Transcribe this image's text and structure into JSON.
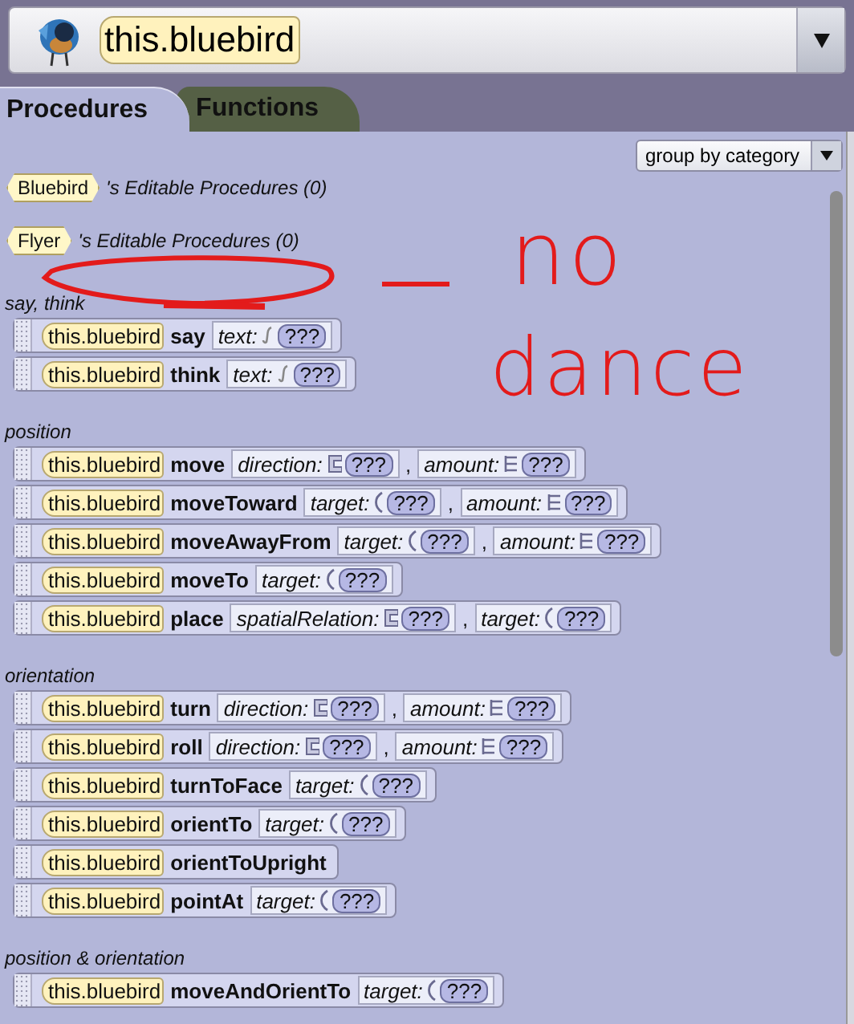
{
  "object_selector": {
    "value": "this.bluebird"
  },
  "tabs": [
    {
      "label": "Procedures",
      "selected": true
    },
    {
      "label": "Functions",
      "selected": false
    }
  ],
  "grouping": {
    "value": "group by category"
  },
  "editable_procedures": [
    {
      "type": "Bluebird",
      "label": "'s Editable Procedures (0)"
    },
    {
      "type": "Flyer",
      "label": "'s Editable Procedures (0)"
    }
  ],
  "categories": [
    {
      "name": "say, think",
      "blocks": [
        {
          "target": "this.bluebird",
          "method": "say",
          "params": [
            {
              "kind": "text",
              "label": "text:",
              "value": "???"
            }
          ]
        },
        {
          "target": "this.bluebird",
          "method": "think",
          "params": [
            {
              "kind": "text",
              "label": "text:",
              "value": "???"
            }
          ]
        }
      ]
    },
    {
      "name": "position",
      "blocks": [
        {
          "target": "this.bluebird",
          "method": "move",
          "separator": ",",
          "params": [
            {
              "kind": "direction",
              "label": "direction:",
              "value": "???"
            },
            {
              "kind": "amount",
              "label": "amount:",
              "value": "???"
            }
          ]
        },
        {
          "target": "this.bluebird",
          "method": "moveToward",
          "separator": ",",
          "params": [
            {
              "kind": "target",
              "label": "target:",
              "value": "???"
            },
            {
              "kind": "amount",
              "label": "amount:",
              "value": "???"
            }
          ]
        },
        {
          "target": "this.bluebird",
          "method": "moveAwayFrom",
          "separator": ",",
          "params": [
            {
              "kind": "target",
              "label": "target:",
              "value": "???"
            },
            {
              "kind": "amount",
              "label": "amount:",
              "value": "???"
            }
          ]
        },
        {
          "target": "this.bluebird",
          "method": "moveTo",
          "params": [
            {
              "kind": "target",
              "label": "target:",
              "value": "???"
            }
          ]
        },
        {
          "target": "this.bluebird",
          "method": "place",
          "separator": ",",
          "params": [
            {
              "kind": "direction",
              "label": "spatialRelation:",
              "value": "???"
            },
            {
              "kind": "target",
              "label": "target:",
              "value": "???"
            }
          ]
        }
      ]
    },
    {
      "name": "orientation",
      "blocks": [
        {
          "target": "this.bluebird",
          "method": "turn",
          "separator": ",",
          "params": [
            {
              "kind": "direction",
              "label": "direction:",
              "value": "???"
            },
            {
              "kind": "amount",
              "label": "amount:",
              "value": "???"
            }
          ]
        },
        {
          "target": "this.bluebird",
          "method": "roll",
          "separator": ",",
          "params": [
            {
              "kind": "direction",
              "label": "direction:",
              "value": "???"
            },
            {
              "kind": "amount",
              "label": "amount:",
              "value": "???"
            }
          ]
        },
        {
          "target": "this.bluebird",
          "method": "turnToFace",
          "params": [
            {
              "kind": "target",
              "label": "target:",
              "value": "???"
            }
          ]
        },
        {
          "target": "this.bluebird",
          "method": "orientTo",
          "params": [
            {
              "kind": "target",
              "label": "target:",
              "value": "???"
            }
          ]
        },
        {
          "target": "this.bluebird",
          "method": "orientToUpright"
        },
        {
          "target": "this.bluebird",
          "method": "pointAt",
          "params": [
            {
              "kind": "target",
              "label": "target:",
              "value": "???"
            }
          ]
        }
      ]
    },
    {
      "name": "position & orientation",
      "blocks": [
        {
          "target": "this.bluebird",
          "method": "moveAndOrientTo",
          "params": [
            {
              "kind": "target",
              "label": "target:",
              "value": "???"
            }
          ]
        }
      ]
    }
  ],
  "annotation": {
    "texts": [
      "no",
      "dance"
    ]
  }
}
